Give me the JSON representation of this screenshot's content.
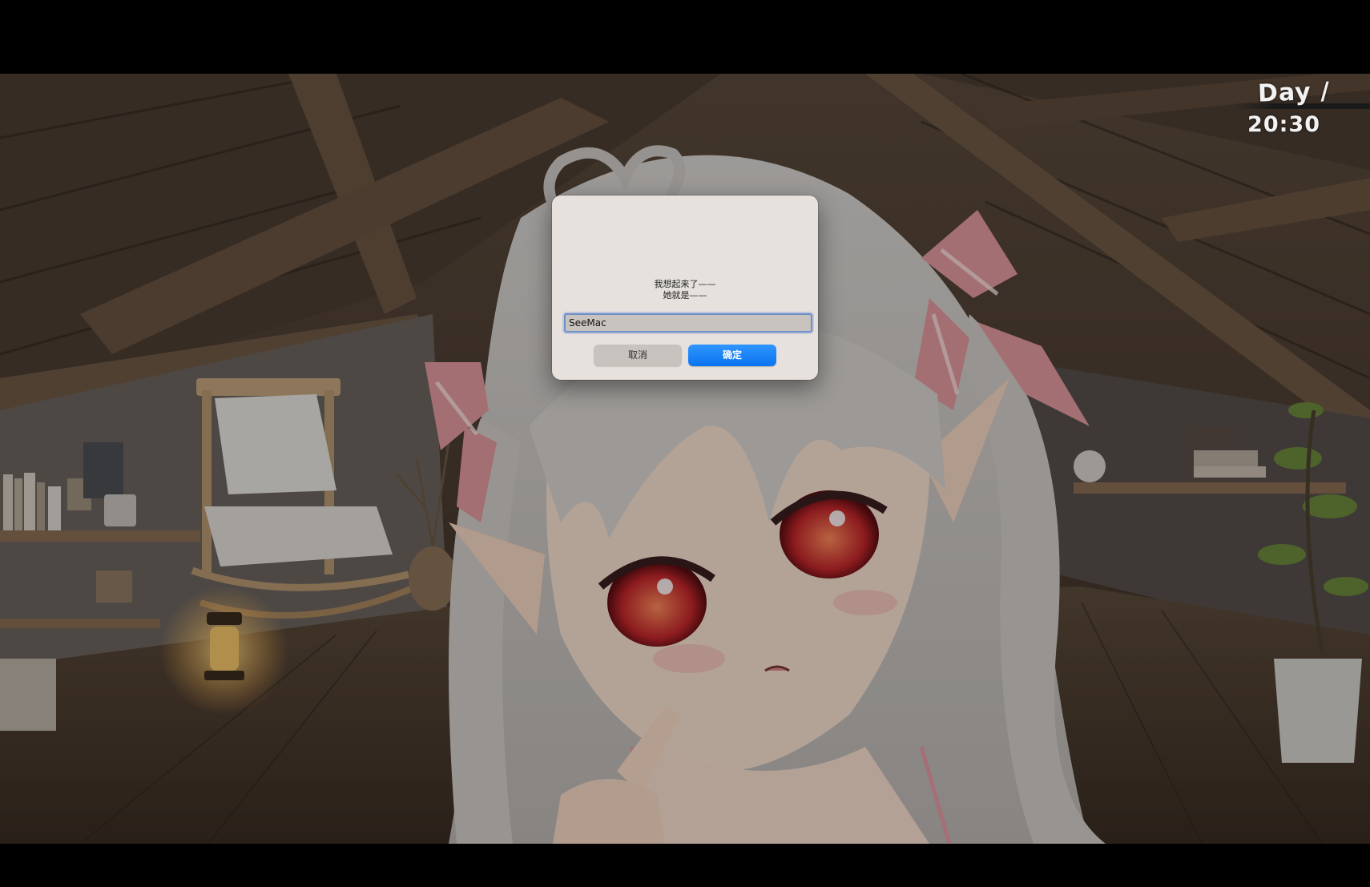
{
  "hud": {
    "day_label": "Day /",
    "time": "20:30"
  },
  "dialog": {
    "message_line1": "我想起来了——",
    "message_line2": "她就是——",
    "input_value": "SeeMac",
    "cancel_label": "取消",
    "confirm_label": "确定"
  },
  "colors": {
    "confirm_button": "#0a74f0",
    "dialog_background": "#e6e1dc",
    "letterbox": "#000000"
  }
}
